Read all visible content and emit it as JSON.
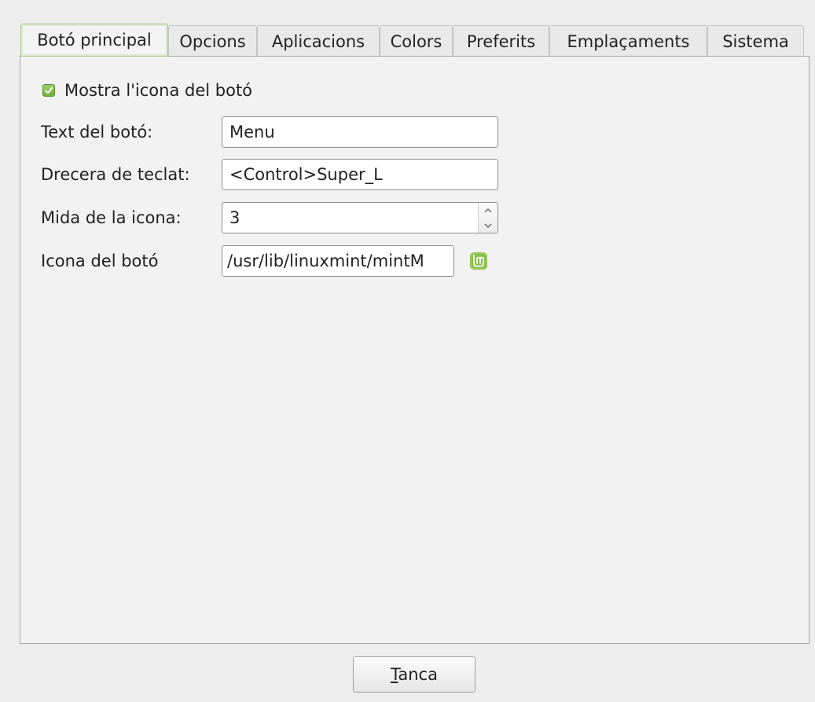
{
  "tabs": [
    {
      "label": "Botó principal",
      "active": true
    },
    {
      "label": "Opcions",
      "active": false
    },
    {
      "label": "Aplicacions",
      "active": false
    },
    {
      "label": "Colors",
      "active": false
    },
    {
      "label": "Preferits",
      "active": false
    },
    {
      "label": "Emplaçaments",
      "active": false
    },
    {
      "label": "Sistema",
      "active": false
    }
  ],
  "main": {
    "show_icon": {
      "label": "Mostra l'icona del botó",
      "checked": true
    },
    "button_text": {
      "label": "Text del botó:",
      "value": "Menu"
    },
    "shortcut": {
      "label": "Drecera de teclat:",
      "value": "<Control>Super_L"
    },
    "icon_size": {
      "label": "Mida de la icona:",
      "value": "3"
    },
    "button_icon": {
      "label": "Icona del botó",
      "value": "/usr/lib/linuxmint/mintM",
      "icon": "linux-mint-icon"
    }
  },
  "footer": {
    "close_mnemonic": "T",
    "close_rest": "anca"
  },
  "colors": {
    "accent_green": "#6faf3f",
    "mint_green": "#86be43"
  }
}
